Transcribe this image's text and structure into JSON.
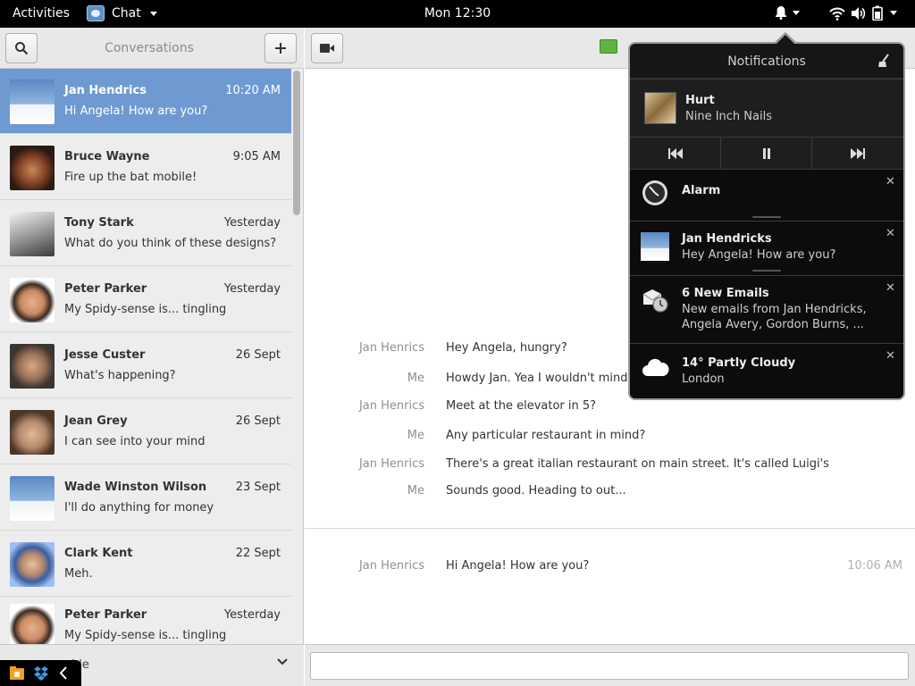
{
  "topbar": {
    "activities": "Activities",
    "app_name": "Chat",
    "clock": "Mon 12:30"
  },
  "conversations_header": {
    "title": "Conversations"
  },
  "conversations": [
    {
      "name": "Jan Hendrics",
      "time": "10:20 AM",
      "message": "Hi Angela! How are you?",
      "selected": true
    },
    {
      "name": "Bruce Wayne",
      "time": "9:05 AM",
      "message": "Fire up the bat mobile!"
    },
    {
      "name": "Tony Stark",
      "time": "Yesterday",
      "message": "What do you think of these designs?"
    },
    {
      "name": "Peter Parker",
      "time": "Yesterday",
      "message": "My Spidy-sense is... tingling"
    },
    {
      "name": "Jesse Custer",
      "time": "26 Sept",
      "message": "What's happening?"
    },
    {
      "name": "Jean Grey",
      "time": "26 Sept",
      "message": "I can see into your mind"
    },
    {
      "name": "Wade Winston Wilson",
      "time": "23 Sept",
      "message": "I'll do anything for money"
    },
    {
      "name": "Clark Kent",
      "time": "22 Sept",
      "message": "Meh."
    },
    {
      "name": "Peter Parker",
      "time": "Yesterday",
      "message": "My Spidy-sense is... tingling"
    }
  ],
  "status_bar": {
    "text": "ble"
  },
  "chat": {
    "messages": [
      {
        "sender": "Jan Henrics",
        "text": "Hey Angela, hungry?"
      },
      {
        "sender": "Me",
        "text": "Howdy Jan. Yea I wouldn't mind"
      },
      {
        "sender": "Jan Henrics",
        "text": "Meet at the elevator in 5?"
      },
      {
        "sender": "Me",
        "text": "Any particular restaurant in mind?"
      },
      {
        "sender": "Jan Henrics",
        "text": "There's a great italian restaurant on main street. It's called Luigi's"
      },
      {
        "sender": "Me",
        "text": "Sounds good. Heading to out..."
      }
    ],
    "latest": {
      "sender": "Jan Henrics",
      "text": "Hi Angela! How are you?",
      "time": "10:06 AM"
    }
  },
  "notifications": {
    "title": "Notifications",
    "music": {
      "title": "Hurt",
      "artist": "Nine Inch Nails"
    },
    "items": [
      {
        "icon": "alarm-clock-icon",
        "title": "Alarm",
        "body": ""
      },
      {
        "icon": "avatar",
        "title": "Jan Hendricks",
        "body": "Hey Angela! How are you?"
      },
      {
        "icon": "mail-icon",
        "title": "6 New Emails",
        "body_lines": [
          "New emails from Jan Hendricks,",
          "Angela Avery, Gordon Burns, ..."
        ]
      },
      {
        "icon": "cloud-icon",
        "title": "14° Partly Cloudy",
        "body": "London"
      }
    ],
    "close_glyph": "✕"
  },
  "colors": {
    "selection": "#6e9ad1",
    "topbar": "#000000",
    "notification_bg": "#161616",
    "presence": "#5fb441"
  }
}
